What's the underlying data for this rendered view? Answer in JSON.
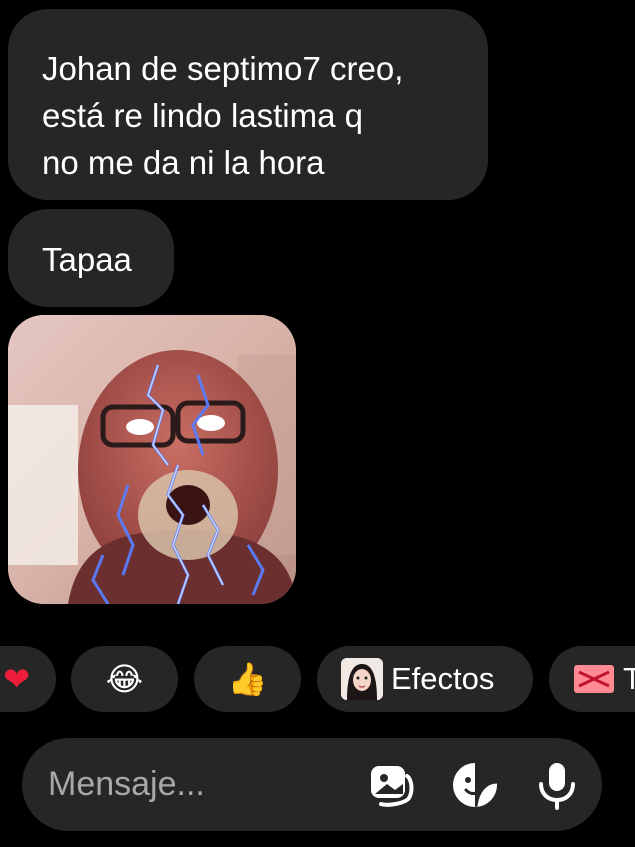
{
  "messages": [
    {
      "text": "Johan de septimo7 creo,\nestá re lindo lastima q\nno me da ni la hora"
    },
    {
      "text": "Tapaa"
    }
  ],
  "photo_message": {
    "icon": "photo-with-lightning-face-filter"
  },
  "quick_reactions": [
    {
      "emoji": "❤"
    },
    {
      "emoji": "😂"
    },
    {
      "emoji": "👍"
    }
  ],
  "effects_chip": {
    "label": "Efectos",
    "icon": "avatar-thumbnail"
  },
  "gift_chip": {
    "label": "T",
    "icon": "gift-icon"
  },
  "composer": {
    "placeholder": "Mensaje...",
    "icons": [
      "gallery-icon",
      "sticker-icon",
      "microphone-icon"
    ]
  },
  "colors": {
    "background": "#000000",
    "bubble": "#262626",
    "text": "#ffffff",
    "placeholder": "#a8a8a8",
    "heart": "#ee1d3a",
    "gift": "#ff8a93"
  }
}
